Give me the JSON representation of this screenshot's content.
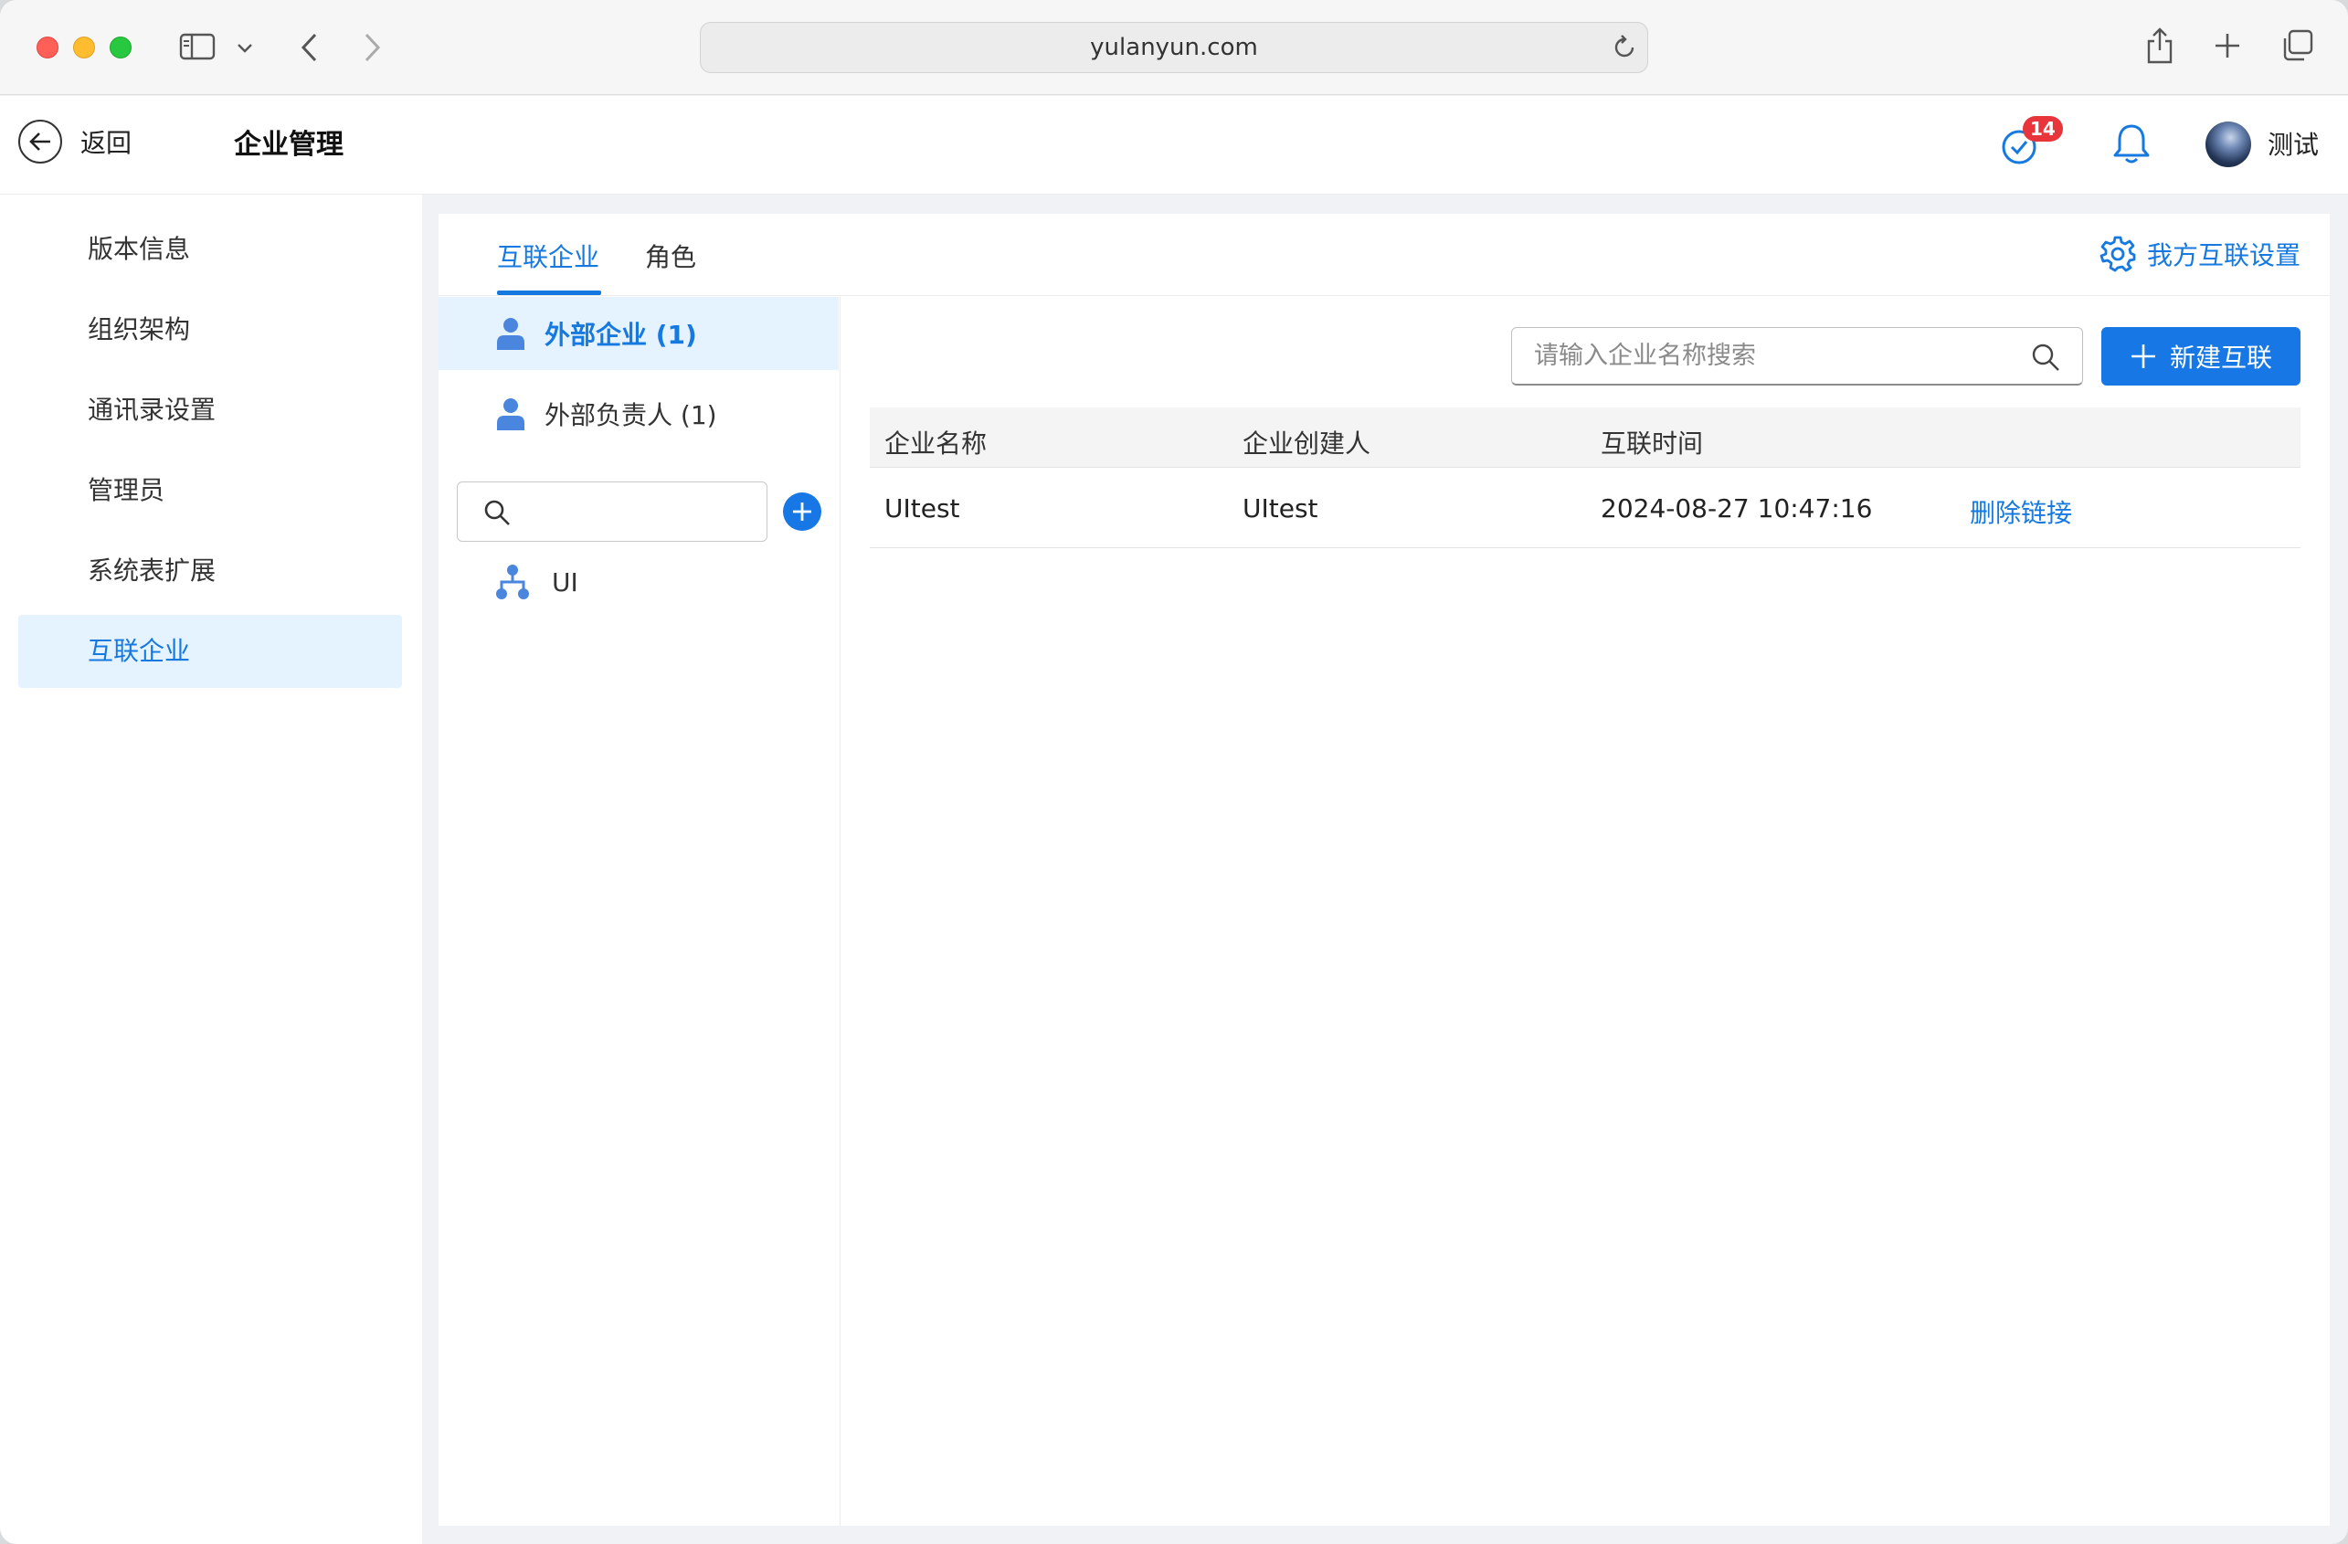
{
  "browser": {
    "url": "yulanyun.com"
  },
  "header": {
    "back_label": "返回",
    "title": "企业管理",
    "todo_badge": "14",
    "username": "测试"
  },
  "sidebar": {
    "items": [
      {
        "label": "版本信息"
      },
      {
        "label": "组织架构"
      },
      {
        "label": "通讯录设置"
      },
      {
        "label": "管理员"
      },
      {
        "label": "系统表扩展"
      },
      {
        "label": "互联企业",
        "active": true
      }
    ]
  },
  "tabs": [
    {
      "label": "互联企业",
      "active": true
    },
    {
      "label": "角色"
    }
  ],
  "settings_link": "我方互联设置",
  "groups": [
    {
      "label": "外部企业 (1)",
      "active": true
    },
    {
      "label": "外部负责人 (1)"
    }
  ],
  "tree": {
    "nodes": [
      {
        "label": "UI"
      }
    ]
  },
  "search": {
    "placeholder": "请输入企业名称搜索",
    "value": ""
  },
  "new_button": "新建互联",
  "table": {
    "columns": [
      "企业名称",
      "企业创建人",
      "互联时间"
    ],
    "rows": [
      {
        "name": "UItest",
        "creator": "UItest",
        "time": "2024-08-27 10:47:16",
        "action": "删除链接"
      }
    ]
  },
  "colors": {
    "accent": "#1579e0",
    "badge": "#e8343b",
    "active_bg": "#e5f2ff"
  }
}
